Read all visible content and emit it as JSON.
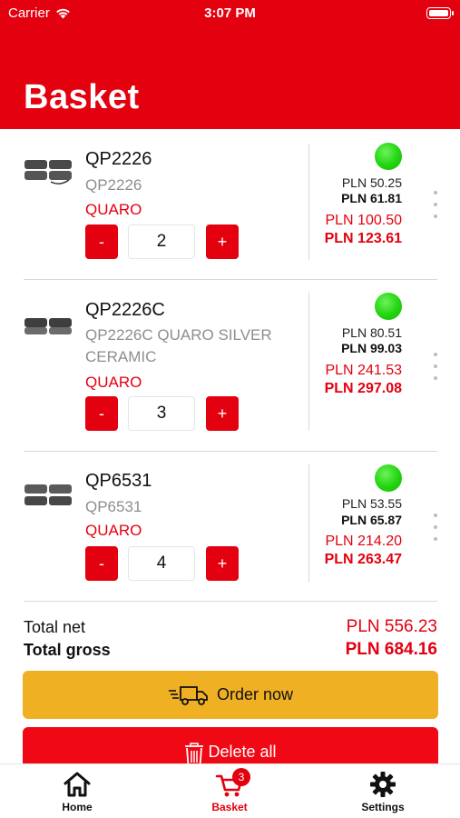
{
  "status_bar": {
    "carrier": "Carrier",
    "time": "3:07 PM"
  },
  "header": {
    "title": "Basket"
  },
  "colors": {
    "brand_red": "#e3000f",
    "order_yellow": "#f0b023",
    "availability_green": "#22d40f"
  },
  "items": [
    {
      "name": "QP2226",
      "description": "QP2226",
      "brand": "QUARO",
      "qty_minus": "-",
      "quantity": "2",
      "qty_plus": "+",
      "availability": "in-stock",
      "unit_net": "PLN 50.25",
      "unit_gross": "PLN 61.81",
      "total_net": "PLN 100.50",
      "total_gross": "PLN 123.61"
    },
    {
      "name": "QP2226C",
      "description": "QP2226C QUARO SILVER CERAMIC",
      "brand": "QUARO",
      "qty_minus": "-",
      "quantity": "3",
      "qty_plus": "+",
      "availability": "in-stock",
      "unit_net": "PLN 80.51",
      "unit_gross": "PLN 99.03",
      "total_net": "PLN 241.53",
      "total_gross": "PLN 297.08"
    },
    {
      "name": "QP6531",
      "description": "QP6531",
      "brand": "QUARO",
      "qty_minus": "-",
      "quantity": "4",
      "qty_plus": "+",
      "availability": "in-stock",
      "unit_net": "PLN 53.55",
      "unit_gross": "PLN 65.87",
      "total_net": "PLN 214.20",
      "total_gross": "PLN 263.47"
    }
  ],
  "totals": {
    "net_label": "Total net",
    "net_value": "PLN 556.23",
    "gross_label": "Total gross",
    "gross_value": "PLN 684.16"
  },
  "actions": {
    "order_label": "Order now",
    "delete_label": "Delete all"
  },
  "tabbar": {
    "home": "Home",
    "basket": "Basket",
    "basket_badge": "3",
    "settings": "Settings"
  }
}
